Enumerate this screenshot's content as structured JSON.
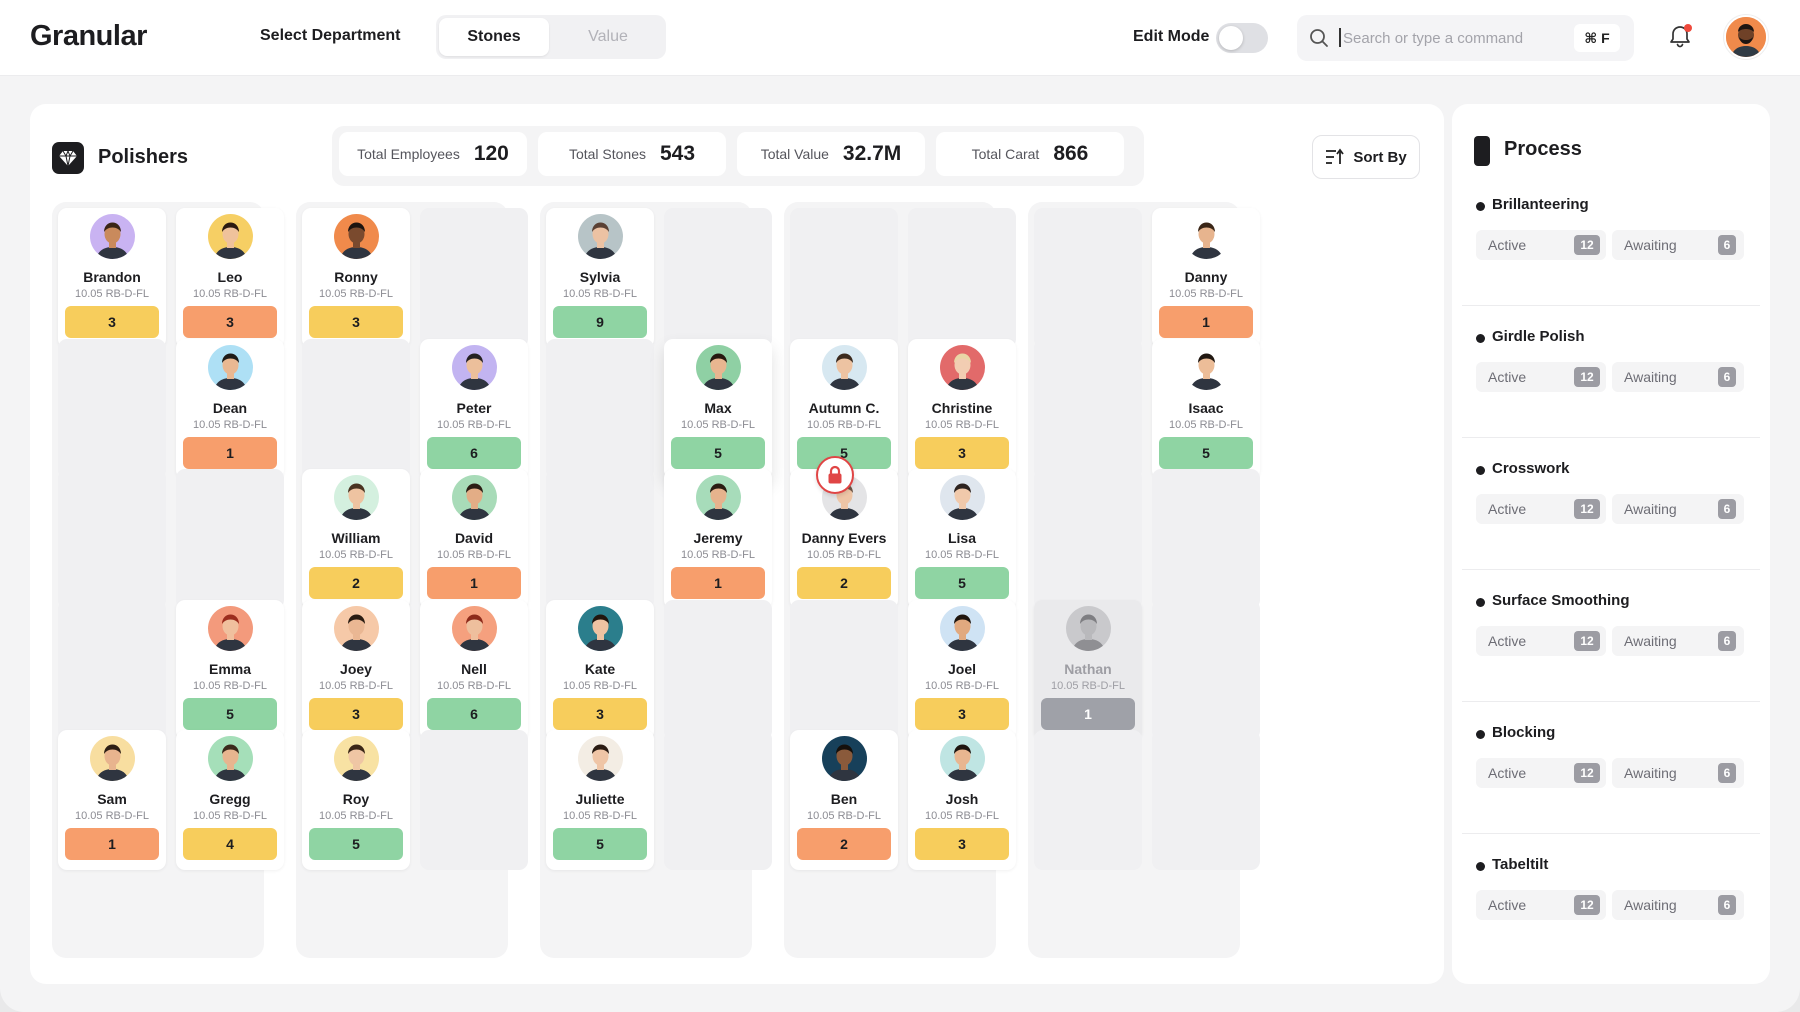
{
  "app": {
    "logo": "Granular"
  },
  "header": {
    "department_label": "Select Department",
    "tabs": [
      "Stones",
      "Value"
    ],
    "edit_mode_label": "Edit Mode",
    "edit_mode": false,
    "search_placeholder": "Search or type a command",
    "search_shortcut": "⌘ F",
    "notification_dot": true
  },
  "board": {
    "title": "Polishers",
    "sort_label": "Sort By",
    "stats": [
      {
        "label": "Total Employees",
        "value": "120"
      },
      {
        "label": "Total Stones",
        "value": "543"
      },
      {
        "label": "Total Value",
        "value": "32.7M"
      },
      {
        "label": "Total Carat",
        "value": "866"
      }
    ],
    "badge_colors": {
      "yellow": "#f7cd5c",
      "orange": "#f79e6c",
      "green": "#8fd4a3",
      "gray": "#9fa1a8"
    },
    "groups": [
      {
        "columns": [
          [
            {
              "name": "Brandon",
              "sub": "10.05 RB-D-FL",
              "count": "3",
              "color": "yellow",
              "avatar_bg": "#c9b3f2",
              "skin": "#c98a5c",
              "hair": "#3a2416"
            },
            null,
            null,
            null,
            {
              "name": "Sam",
              "sub": "10.05 RB-D-FL",
              "count": "1",
              "color": "orange",
              "avatar_bg": "#f8dea0",
              "skin": "#e8b48e",
              "hair": "#2d1e14"
            }
          ],
          [
            {
              "name": "Leo",
              "sub": "10.05 RB-D-FL",
              "count": "3",
              "color": "orange",
              "avatar_bg": "#f6cf64",
              "skin": "#efc29b",
              "hair": "#2b1a10"
            },
            {
              "name": "Dean",
              "sub": "10.05 RB-D-FL",
              "count": "1",
              "color": "orange",
              "avatar_bg": "#aee0f5",
              "skin": "#e9b892",
              "hair": "#1e1b18"
            },
            null,
            {
              "name": "Emma",
              "sub": "10.05 RB-D-FL",
              "count": "5",
              "color": "green",
              "avatar_bg": "#f39a7c",
              "skin": "#f0c09e",
              "hair": "#9c2d1e"
            },
            {
              "name": "Gregg",
              "sub": "10.05 RB-D-FL",
              "count": "4",
              "color": "yellow",
              "avatar_bg": "#a5dfb9",
              "skin": "#e7b58f",
              "hair": "#3b2a1c"
            }
          ]
        ]
      },
      {
        "columns": [
          [
            {
              "name": "Ronny",
              "sub": "10.05 RB-D-FL",
              "count": "3",
              "color": "yellow",
              "avatar_bg": "#f08a4b",
              "skin": "#7a4a2e",
              "hair": "#1c1410"
            },
            null,
            {
              "name": "William",
              "sub": "10.05 RB-D-FL",
              "count": "2",
              "color": "yellow",
              "avatar_bg": "#d4f0df",
              "skin": "#eec3a1",
              "hair": "#4a3321"
            },
            {
              "name": "Joey",
              "sub": "10.05 RB-D-FL",
              "count": "3",
              "color": "yellow",
              "avatar_bg": "#f6c9a8",
              "skin": "#eab793",
              "hair": "#2a1c12"
            },
            {
              "name": "Roy",
              "sub": "10.05 RB-D-FL",
              "count": "5",
              "color": "green",
              "avatar_bg": "#f8e2a3",
              "skin": "#efc6a4",
              "hair": "#3a2616"
            }
          ],
          [
            null,
            {
              "name": "Peter",
              "sub": "10.05 RB-D-FL",
              "count": "6",
              "color": "green",
              "avatar_bg": "#c2b4f1",
              "skin": "#ecbf9b",
              "hair": "#242021"
            },
            {
              "name": "David",
              "sub": "10.05 RB-D-FL",
              "count": "1",
              "color": "orange",
              "avatar_bg": "#a8dbb8",
              "skin": "#e3ad86",
              "hair": "#2b1d14"
            },
            {
              "name": "Nell",
              "sub": "10.05 RB-D-FL",
              "count": "6",
              "color": "green",
              "avatar_bg": "#f5a07e",
              "skin": "#eebf9d",
              "hair": "#8d2a1a"
            },
            null
          ]
        ]
      },
      {
        "columns": [
          [
            {
              "name": "Sylvia",
              "sub": "10.05 RB-D-FL",
              "count": "9",
              "color": "green",
              "avatar_bg": "#b7c4c7",
              "skin": "#ecc2a3",
              "hair": "#5a4134"
            },
            null,
            null,
            {
              "name": "Kate",
              "sub": "10.05 RB-D-FL",
              "count": "3",
              "color": "yellow",
              "avatar_bg": "#2b7e8c",
              "skin": "#eec3a2",
              "hair": "#21160f"
            },
            {
              "name": "Juliette",
              "sub": "10.05 RB-D-FL",
              "count": "5",
              "color": "green",
              "avatar_bg": "#f3ede4",
              "skin": "#efc5a6",
              "hair": "#2a1b12"
            }
          ],
          [
            null,
            {
              "name": "Max",
              "sub": "10.05 RB-D-FL",
              "count": "5",
              "color": "green",
              "avatar_bg": "#8fd0a4",
              "skin": "#e8b690",
              "hair": "#26190f",
              "locked": true
            },
            {
              "name": "Jeremy",
              "sub": "10.05 RB-D-FL",
              "count": "1",
              "color": "orange",
              "avatar_bg": "#a7dcba",
              "skin": "#e6b38d",
              "hair": "#2a1c12"
            },
            null,
            null
          ]
        ]
      },
      {
        "columns": [
          [
            null,
            {
              "name": "Autumn C.",
              "sub": "10.05 RB-D-FL",
              "count": "5",
              "color": "green",
              "avatar_bg": "#d7e8f1",
              "skin": "#edc3a2",
              "hair": "#3b2a1e"
            },
            {
              "name": "Danny Evers",
              "sub": "10.05 RB-D-FL",
              "count": "2",
              "color": "yellow",
              "avatar_bg": "#e4e4e6",
              "skin": "#eec5a6",
              "hair": "#6b5344"
            },
            null,
            {
              "name": "Ben",
              "sub": "10.05 RB-D-FL",
              "count": "2",
              "color": "orange",
              "avatar_bg": "#17405a",
              "skin": "#8a5a3b",
              "hair": "#15100c"
            }
          ],
          [
            null,
            {
              "name": "Christine",
              "sub": "10.05 RB-D-FL",
              "count": "3",
              "color": "yellow",
              "avatar_bg": "#e26a6a",
              "skin": "#f2cdb2",
              "hair": "#e9d6a6"
            },
            {
              "name": "Lisa",
              "sub": "10.05 RB-D-FL",
              "count": "5",
              "color": "green",
              "avatar_bg": "#dfe6ee",
              "skin": "#f0c9ab",
              "hair": "#2d2320"
            },
            {
              "name": "Joel",
              "sub": "10.05 RB-D-FL",
              "count": "3",
              "color": "yellow",
              "avatar_bg": "#cfe3f4",
              "skin": "#e1a97f",
              "hair": "#1f160f"
            },
            {
              "name": "Josh",
              "sub": "10.05 RB-D-FL",
              "count": "3",
              "color": "yellow",
              "avatar_bg": "#bfe5e3",
              "skin": "#e8b690",
              "hair": "#1d1510"
            }
          ]
        ]
      },
      {
        "columns": [
          [
            null,
            null,
            null,
            {
              "name": "Nathan",
              "sub": "10.05 RB-D-FL",
              "count": "1",
              "color": "gray",
              "avatar_bg": "#c9c9cc",
              "skin": "#b9b9bc",
              "hair": "#7e7e82",
              "faded": true
            },
            null
          ],
          [
            {
              "name": "Danny",
              "sub": "10.05 RB-D-FL",
              "count": "1",
              "color": "orange",
              "avatar_bg": "#ffffff",
              "skin": "#e7b48e",
              "hair": "#3a2617"
            },
            {
              "name": "Isaac",
              "sub": "10.05 RB-D-FL",
              "count": "5",
              "color": "green",
              "avatar_bg": "#ffffff",
              "skin": "#ecbd98",
              "hair": "#211812"
            },
            null,
            null,
            null
          ]
        ]
      }
    ]
  },
  "process": {
    "title": "Process",
    "items": [
      {
        "name": "Brillanteering",
        "active_label": "Active",
        "active_count": "12",
        "awaiting_label": "Awaiting",
        "awaiting_count": "6"
      },
      {
        "name": "Girdle Polish",
        "active_label": "Active",
        "active_count": "12",
        "awaiting_label": "Awaiting",
        "awaiting_count": "6"
      },
      {
        "name": "Crosswork",
        "active_label": "Active",
        "active_count": "12",
        "awaiting_label": "Awaiting",
        "awaiting_count": "6"
      },
      {
        "name": "Surface Smoothing",
        "active_label": "Active",
        "active_count": "12",
        "awaiting_label": "Awaiting",
        "awaiting_count": "6"
      },
      {
        "name": "Blocking",
        "active_label": "Active",
        "active_count": "12",
        "awaiting_label": "Awaiting",
        "awaiting_count": "6"
      },
      {
        "name": "Tabeltilt",
        "active_label": "Active",
        "active_count": "12",
        "awaiting_label": "Awaiting",
        "awaiting_count": "6"
      }
    ]
  }
}
